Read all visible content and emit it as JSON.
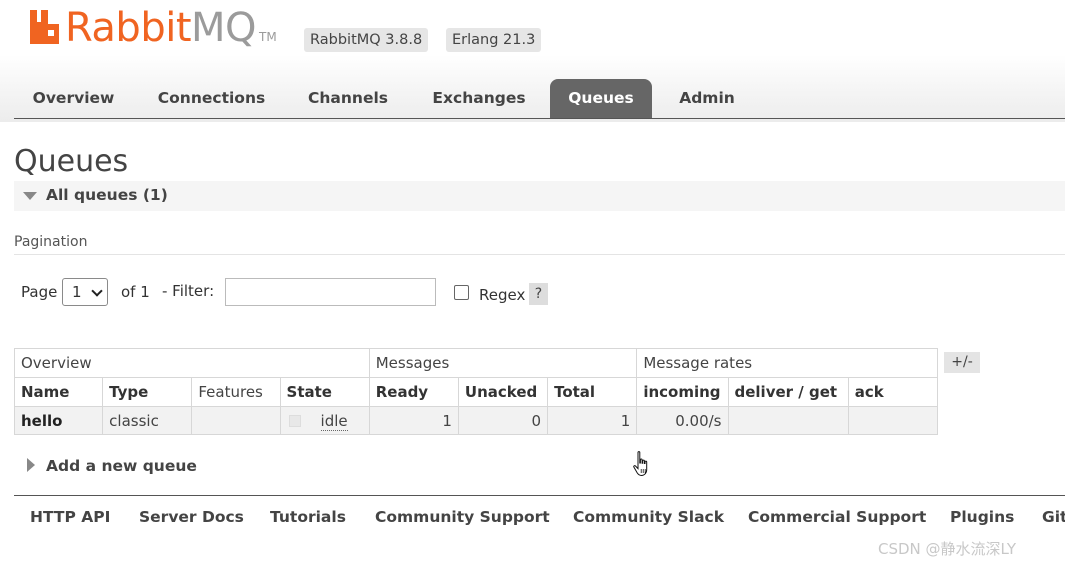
{
  "brand": {
    "name_part1": "Rabbit",
    "name_part2": "MQ",
    "tm": "TM",
    "accent_color": "#f06421"
  },
  "badges": {
    "version": "RabbitMQ 3.8.8",
    "erlang": "Erlang 21.3"
  },
  "tabs": [
    {
      "label": "Overview"
    },
    {
      "label": "Connections"
    },
    {
      "label": "Channels"
    },
    {
      "label": "Exchanges"
    },
    {
      "label": "Queues",
      "active": true
    },
    {
      "label": "Admin"
    }
  ],
  "page": {
    "title": "Queues",
    "section_title": "All queues (1)",
    "pagination_label": "Pagination"
  },
  "filter": {
    "page_label": "Page",
    "page_value": "1",
    "of_label": "of 1",
    "filter_label": "- Filter:",
    "filter_value": "",
    "regex_label": "Regex",
    "regex_checked": false,
    "help_label": "?"
  },
  "table": {
    "groups": [
      "Overview",
      "Messages",
      "Message rates"
    ],
    "columns": [
      "Name",
      "Type",
      "Features",
      "State",
      "Ready",
      "Unacked",
      "Total",
      "incoming",
      "deliver / get",
      "ack"
    ],
    "rows": [
      {
        "name": "hello",
        "type": "classic",
        "features": "",
        "state": "idle",
        "ready": "1",
        "unacked": "0",
        "total": "1",
        "incoming": "0.00/s",
        "deliver_get": "",
        "ack": ""
      }
    ],
    "toggle_columns_label": "+/-"
  },
  "add_queue": {
    "label": "Add a new queue"
  },
  "footer": {
    "links": [
      "HTTP API",
      "Server Docs",
      "Tutorials",
      "Community Support",
      "Community Slack",
      "Commercial Support",
      "Plugins",
      "Git"
    ]
  },
  "watermark": "CSDN @静水流深LY",
  "icons": {
    "logo": "rabbitmq-logo-icon",
    "section_toggle": "triangle-down-icon",
    "add_queue_toggle": "triangle-right-icon",
    "select": "chevron-down-icon",
    "cursor": "hand-pointer-icon"
  }
}
